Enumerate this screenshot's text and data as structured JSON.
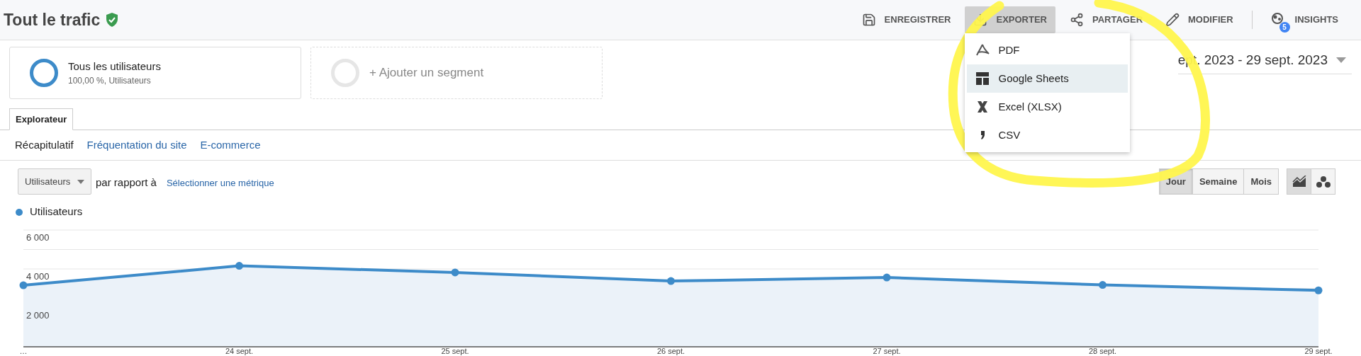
{
  "report": {
    "title": "Tout le trafic",
    "verified": true
  },
  "toolbar": [
    {
      "label": "ENREGISTRER",
      "kind": "save",
      "selected": false
    },
    {
      "label": "EXPORTER",
      "kind": "export",
      "selected": true
    },
    {
      "label": "PARTAGER",
      "kind": "share",
      "selected": false
    },
    {
      "label": "MODIFIER",
      "kind": "edit",
      "selected": false
    },
    {
      "label": "INSIGHTS",
      "kind": "insights",
      "selected": false,
      "badge": "5"
    }
  ],
  "export_menu": [
    {
      "label": "PDF",
      "kind": "pdf",
      "selected": false
    },
    {
      "label": "Google Sheets",
      "kind": "sheets",
      "selected": true
    },
    {
      "label": "Excel (XLSX)",
      "kind": "excel",
      "selected": false
    },
    {
      "label": "CSV",
      "kind": "csv",
      "selected": false
    }
  ],
  "segments": [
    {
      "kind": "active",
      "title": "Tous les utilisateurs",
      "subtitle": "100,00 %, Utilisateurs"
    },
    {
      "kind": "add",
      "title": "+ Ajouter un segment"
    }
  ],
  "date_range": "ept. 2023 - 29 sept. 2023",
  "tabs": [
    {
      "label": "Explorateur",
      "selected": true
    }
  ],
  "subtabs": [
    {
      "label": "Récapitulatif",
      "selected": true
    },
    {
      "label": "Fréquentation du site",
      "selected": false
    },
    {
      "label": "E-commerce",
      "selected": false
    }
  ],
  "metric": {
    "value": "Utilisateurs",
    "compare_label": "par rapport à",
    "compare_link": "Sélectionner une métrique"
  },
  "granularity": [
    {
      "label": "Jour",
      "selected": true
    },
    {
      "label": "Semaine",
      "selected": false
    },
    {
      "label": "Mois",
      "selected": false
    }
  ],
  "chart_types": [
    {
      "kind": "line",
      "selected": true
    },
    {
      "kind": "motion",
      "selected": false
    }
  ],
  "chart": {
    "chart_data": {
      "type": "area",
      "categories": [
        "…",
        "24 sept.",
        "25 sept.",
        "26 sept.",
        "27 sept.",
        "28 sept.",
        "29 sept."
      ],
      "series": [
        {
          "name": "Utilisateurs",
          "color": "#3d8bc9",
          "values": [
            3160,
            4160,
            3820,
            3380,
            3560,
            3180,
            2900
          ]
        }
      ],
      "ylim": [
        0,
        6000
      ],
      "yticks": [
        {
          "value": 2000,
          "label": "2 000"
        },
        {
          "value": 4000,
          "label": "4 000"
        },
        {
          "value": 6000,
          "label": "6 000"
        }
      ]
    }
  }
}
